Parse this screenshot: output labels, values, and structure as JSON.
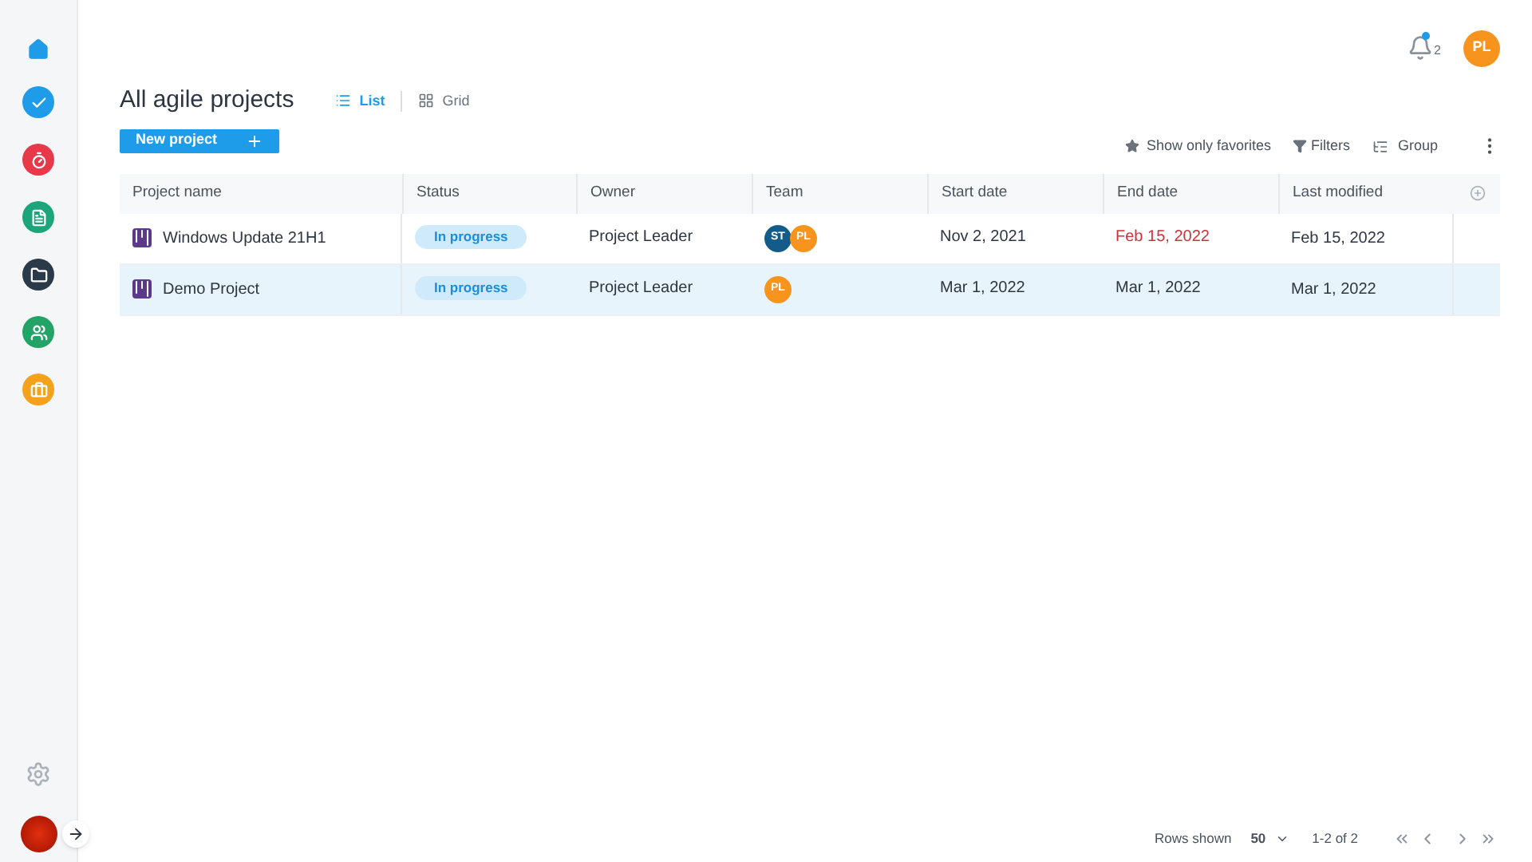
{
  "sidebar": {
    "items": [
      {
        "kind": "home",
        "color": "#1e9be9"
      },
      {
        "kind": "tasks",
        "color": "#1e9be9"
      },
      {
        "kind": "timer",
        "color": "#e8394a"
      },
      {
        "kind": "report",
        "color": "#1ca57a"
      },
      {
        "kind": "folder",
        "color": "#2b3a48"
      },
      {
        "kind": "team",
        "color": "#21a466"
      },
      {
        "kind": "briefcase",
        "color": "#f5a11c"
      }
    ]
  },
  "header": {
    "notifications": "2",
    "user_initials": "PL"
  },
  "page": {
    "title": "All agile projects",
    "views": [
      {
        "label": "List",
        "selected": true
      },
      {
        "label": "Grid",
        "selected": false
      }
    ],
    "new_button": "New project"
  },
  "toolbar": {
    "favorites": "Show only favorites",
    "filters": "Filters",
    "group": "Group"
  },
  "table": {
    "columns": [
      "Project name",
      "Status",
      "Owner",
      "Team",
      "Start date",
      "End date",
      "Last modified"
    ],
    "rows": [
      {
        "name": "Windows Update 21H1",
        "status": "In progress",
        "owner": "Project Leader",
        "team": [
          {
            "initials": "ST",
            "color": "#135c8a"
          },
          {
            "initials": "PL",
            "color": "#f7941d"
          }
        ],
        "start": "Nov 2, 2021",
        "end": "Feb 15, 2022",
        "end_overdue": true,
        "modified": "Feb 15, 2022",
        "selected": false
      },
      {
        "name": "Demo Project",
        "status": "In progress",
        "owner": "Project Leader",
        "team": [
          {
            "initials": "PL",
            "color": "#f7941d"
          }
        ],
        "start": "Mar 1, 2022",
        "end": "Mar 1, 2022",
        "end_overdue": false,
        "modified": "Mar 1, 2022",
        "selected": true
      }
    ]
  },
  "footer": {
    "rows_label": "Rows shown",
    "rows_value": "50",
    "range": "1-2 of 2"
  }
}
